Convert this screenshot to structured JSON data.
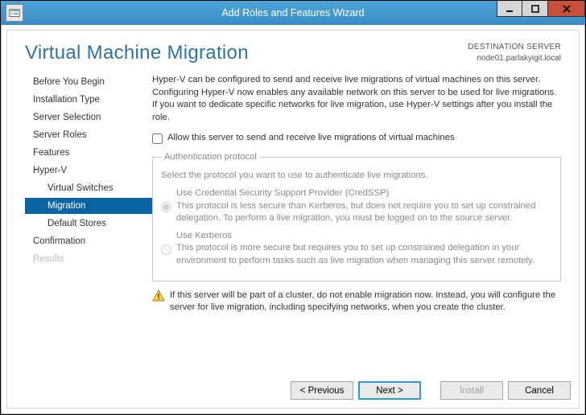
{
  "window": {
    "title": "Add Roles and Features Wizard"
  },
  "header": {
    "page_title": "Virtual Machine Migration",
    "dest_label": "DESTINATION SERVER",
    "dest_value": "node01.parlakyigit.local"
  },
  "nav": {
    "items": [
      {
        "label": "Before You Begin",
        "selected": false,
        "sub": false
      },
      {
        "label": "Installation Type",
        "selected": false,
        "sub": false
      },
      {
        "label": "Server Selection",
        "selected": false,
        "sub": false
      },
      {
        "label": "Server Roles",
        "selected": false,
        "sub": false
      },
      {
        "label": "Features",
        "selected": false,
        "sub": false
      },
      {
        "label": "Hyper-V",
        "selected": false,
        "sub": false
      },
      {
        "label": "Virtual Switches",
        "selected": false,
        "sub": true
      },
      {
        "label": "Migration",
        "selected": true,
        "sub": true
      },
      {
        "label": "Default Stores",
        "selected": false,
        "sub": true
      },
      {
        "label": "Confirmation",
        "selected": false,
        "sub": false
      },
      {
        "label": "Results",
        "selected": false,
        "sub": false,
        "disabled": true
      }
    ]
  },
  "main": {
    "intro": "Hyper-V can be configured to send and receive live migrations of virtual machines on this server. Configuring Hyper-V now enables any available network on this server to be used for live migrations. If you want to dedicate specific networks for live migration, use Hyper-V settings after you install the role.",
    "allow_checkbox_label": "Allow this server to send and receive live migrations of virtual machines",
    "allow_checkbox_checked": false,
    "auth": {
      "legend": "Authentication protocol",
      "hint": "Select the protocol you want to use to authenticate live migrations.",
      "options": [
        {
          "label": "Use Credential Security Support Provider (CredSSP)",
          "desc": "This protocol is less secure than Kerberos, but does not require you to set up constrained delegation. To perform a live migration, you must be logged on to the source server.",
          "checked": true
        },
        {
          "label": "Use Kerberos",
          "desc": "This protocol is more secure but requires you to set up constrained delegation in your environment to perform tasks such as live migration when managing this server remotely.",
          "checked": false
        }
      ]
    },
    "warning": "If this server will be part of a cluster, do not enable migration now. Instead, you will configure the server for live migration, including specifying networks, when you create the cluster."
  },
  "footer": {
    "previous": "< Previous",
    "next": "Next >",
    "install": "Install",
    "cancel": "Cancel"
  }
}
